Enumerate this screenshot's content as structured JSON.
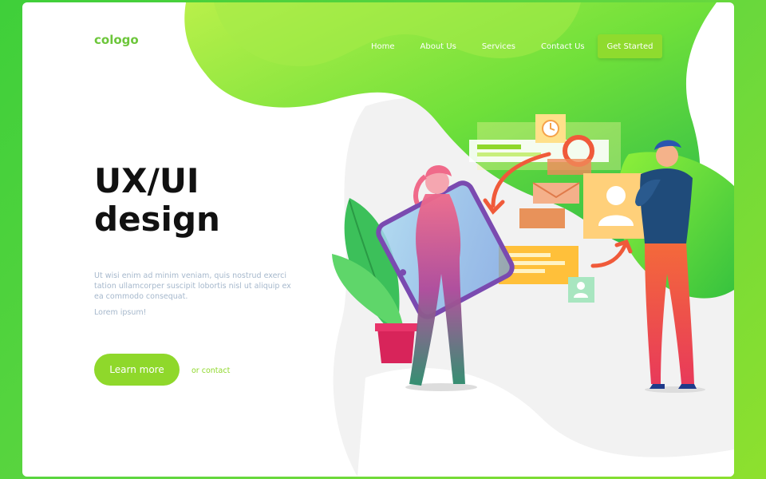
{
  "brand": {
    "logo": "cologo"
  },
  "nav": {
    "items": [
      "Home",
      "About Us",
      "Services",
      "Contact Us"
    ],
    "cta": "Get Started"
  },
  "hero": {
    "title_line1": "UX/UI",
    "title_line2": "design",
    "body": "Ut wisi enim ad minim veniam, quis nostrud exerci tation ullamcorper suscipit lobortis nisl ut aliquip ex ea commodo consequat.",
    "small": "Lorem ipsum!",
    "primary_button": "Learn more",
    "secondary_link": "or contact"
  },
  "colors": {
    "accent": "#8fd82b",
    "brand": "#6cc63a",
    "muted_text": "#a6b8cc"
  }
}
